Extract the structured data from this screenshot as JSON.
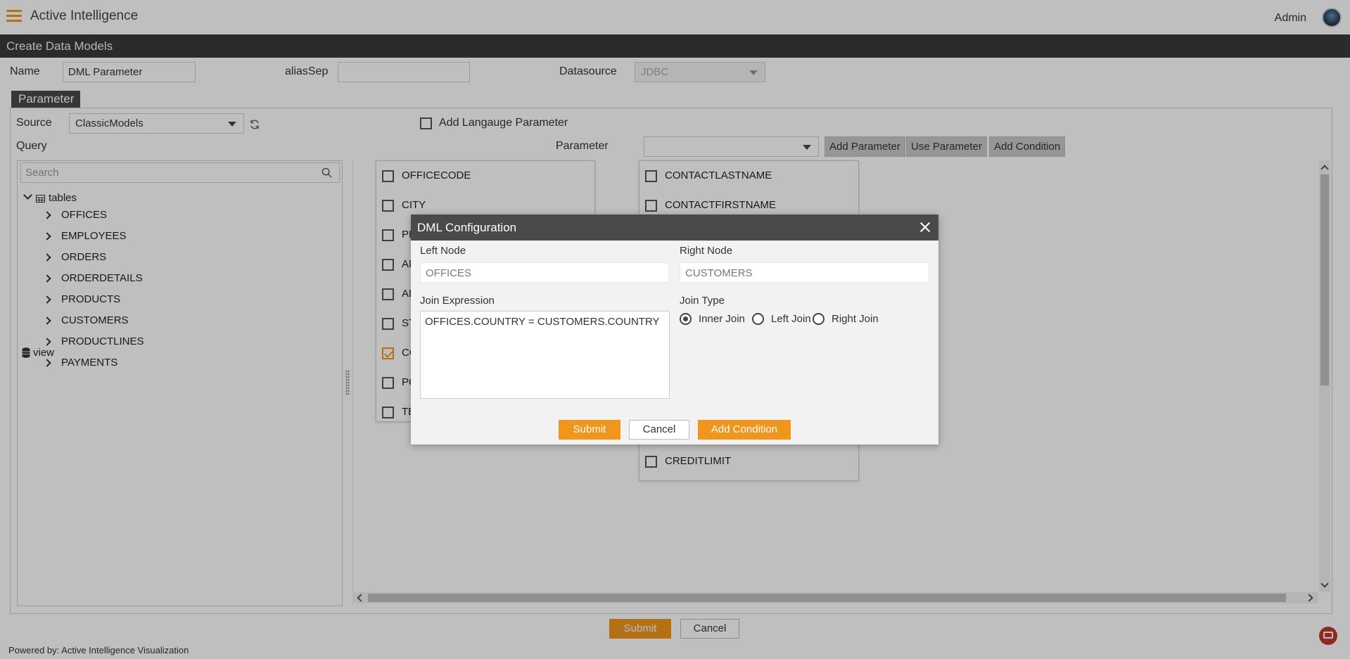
{
  "header": {
    "app_title": "Active Intelligence",
    "user": "Admin"
  },
  "subheader": {
    "title": "Create Data Models"
  },
  "form": {
    "name_label": "Name",
    "name_value": "DML Parameter",
    "alias_label": "aliasSep",
    "alias_value": "",
    "datasource_label": "Datasource",
    "datasource_value": "JDBC"
  },
  "parameter_panel": {
    "tab_label": "Parameter",
    "source_label": "Source",
    "source_value": "ClassicModels",
    "language_param_label": "Add Langauge Parameter",
    "query_label": "Query",
    "parameter_label": "Parameter",
    "parameter_value": "",
    "buttons": {
      "add_parameter": "Add Parameter",
      "use_parameter": "Use Parameter",
      "add_condition": "Add Condition"
    }
  },
  "tree": {
    "search_placeholder": "Search",
    "root_label": "tables",
    "tables": [
      "OFFICES",
      "EMPLOYEES",
      "ORDERS",
      "ORDERDETAILS",
      "PRODUCTS",
      "CUSTOMERS",
      "PRODUCTLINES",
      "PAYMENTS"
    ],
    "view_label": "view"
  },
  "canvas": {
    "offices_columns": [
      {
        "label": "OFFICECODE",
        "checked": false
      },
      {
        "label": "CITY",
        "checked": false
      },
      {
        "label": "PH",
        "checked": false
      },
      {
        "label": "AD",
        "checked": false
      },
      {
        "label": "AD",
        "checked": false
      },
      {
        "label": "ST",
        "checked": false
      },
      {
        "label": "CO",
        "checked": true
      },
      {
        "label": "PO",
        "checked": false
      },
      {
        "label": "TE",
        "checked": false
      }
    ],
    "customers_columns": [
      {
        "label": "CONTACTLASTNAME",
        "checked": false
      },
      {
        "label": "CONTACTFIRSTNAME",
        "checked": false
      },
      {
        "label": "CREDITLIMIT",
        "checked": false
      }
    ]
  },
  "footer_buttons": {
    "submit": "Submit",
    "cancel": "Cancel"
  },
  "footer": {
    "powered_by": "Powered by: Active Intelligence Visualization"
  },
  "modal": {
    "title": "DML Configuration",
    "left_node_label": "Left Node",
    "left_node_value": "OFFICES",
    "right_node_label": "Right Node",
    "right_node_value": "CUSTOMERS",
    "join_expression_label": "Join Expression",
    "join_expression_value": "OFFICES.COUNTRY = CUSTOMERS.COUNTRY",
    "join_type_label": "Join Type",
    "join_types": [
      {
        "label": "Inner Join",
        "selected": true
      },
      {
        "label": "Left Join",
        "selected": false
      },
      {
        "label": "Right Join",
        "selected": false
      }
    ],
    "buttons": {
      "submit": "Submit",
      "cancel": "Cancel",
      "add_condition": "Add Condition"
    }
  },
  "colors": {
    "accent": "#f0961c",
    "header_dark": "#3a3a3a",
    "modal_header": "#4a4a4a"
  }
}
